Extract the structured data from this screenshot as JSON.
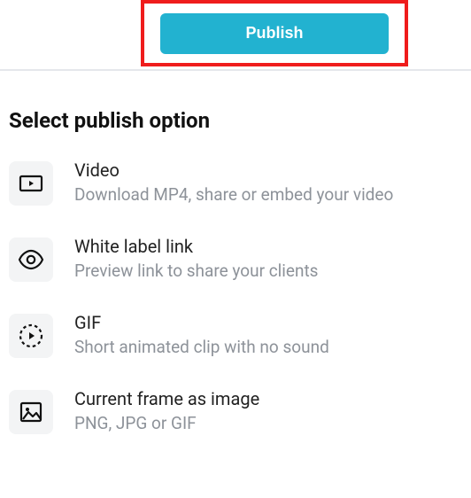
{
  "header": {
    "publish_label": "Publish"
  },
  "section_title": "Select publish option",
  "options": [
    {
      "title": "Video",
      "desc": "Download MP4, share or embed your video"
    },
    {
      "title": "White label link",
      "desc": "Preview link to share your clients"
    },
    {
      "title": "GIF",
      "desc": "Short animated clip with no sound"
    },
    {
      "title": "Current frame as image",
      "desc": "PNG, JPG or GIF"
    }
  ],
  "colors": {
    "accent": "#22b2d0",
    "highlight_border": "#ef1c1c"
  }
}
